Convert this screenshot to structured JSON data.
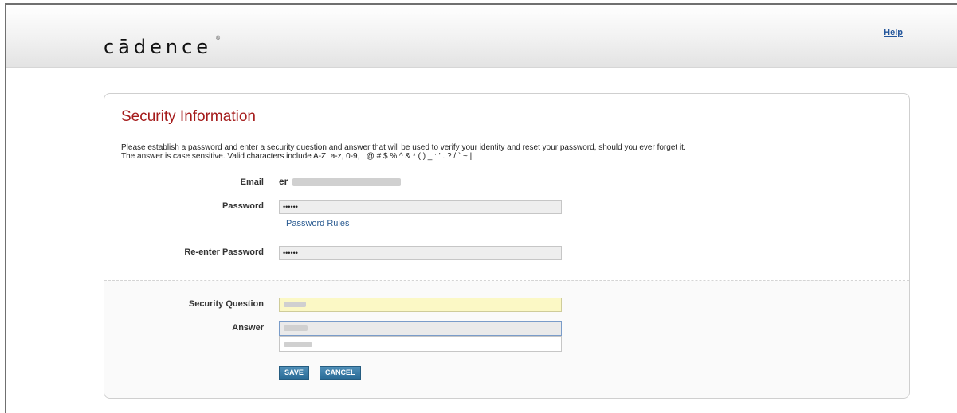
{
  "header": {
    "logo_text": "cādence",
    "logo_mark": "®",
    "help_label": "Help"
  },
  "form": {
    "title": "Security Information",
    "intro_line1": "Please establish a password and enter a security question and answer that will be used to verify your identity and reset your password, should you ever forget it.",
    "intro_line2": "The answer is case sensitive. Valid characters include A-Z, a-z, 0-9, ! @ # $ % ^ & * ( ) _ : ' . ? / ` ~ |",
    "email_label": "Email",
    "email_value": "er",
    "password_label": "Password",
    "password_value": "••••••",
    "password_rules_link": "Password Rules",
    "reenter_label": "Re-enter Password",
    "reenter_value": "••••••",
    "question_label": "Security Question",
    "question_value": "",
    "answer_label": "Answer",
    "answer_value": "",
    "save_label": "SAVE",
    "cancel_label": "CANCEL"
  },
  "colors": {
    "title": "#a51c1c",
    "link": "#22559b",
    "button": "#2b6c97",
    "question_field": "#fbf8c5"
  }
}
